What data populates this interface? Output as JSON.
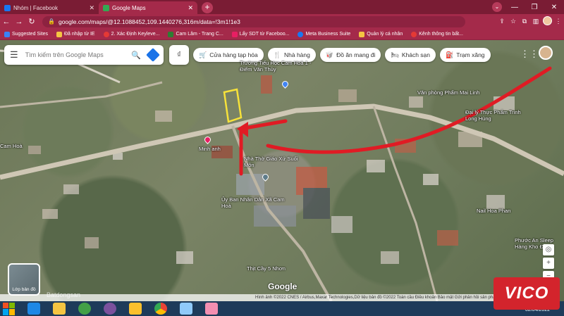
{
  "browser": {
    "tabs": [
      {
        "title": "Nhóm | Facebook",
        "active": false
      },
      {
        "title": "Google Maps",
        "active": true
      }
    ],
    "new_tab": "+",
    "url": "google.com/maps/@12.1088452,109.1440276,316m/data=!3m1!1e3",
    "bookmarks": [
      {
        "label": "Suggested Sites",
        "color": "#3b82f6"
      },
      {
        "label": "Đã nhập từ IE",
        "color": "#f5c542"
      },
      {
        "label": "2. Xác Định Keyleve...",
        "color": "#e53935"
      },
      {
        "label": "Cam Lâm - Trang C...",
        "color": "#2e7d32"
      },
      {
        "label": "Lấy SDT từ Faceboo...",
        "color": "#e91e63"
      },
      {
        "label": "Meta Business Suite",
        "color": "#1877f2"
      },
      {
        "label": "Quản lý cá nhân",
        "color": "#f5c542"
      },
      {
        "label": "Kênh thông tin bất...",
        "color": "#e53935"
      }
    ]
  },
  "maps": {
    "search_placeholder": "Tìm kiếm trên Google Maps",
    "chips": [
      {
        "icon": "cart-icon",
        "glyph": "🛒",
        "label": "Cửa hàng tạp hóa"
      },
      {
        "icon": "restaurant-icon",
        "glyph": "🍴",
        "label": "Nhà hàng"
      },
      {
        "icon": "takeout-icon",
        "glyph": "🥡",
        "label": "Đồ ăn mang đi"
      },
      {
        "icon": "hotel-icon",
        "glyph": "🛏",
        "label": "Khách sạn"
      },
      {
        "icon": "gas-station-icon",
        "glyph": "⛽",
        "label": "Trạm xăng"
      }
    ],
    "labels": {
      "school": "Trường Tiểu Học Cam Hoà 1 - Điểm Văn Thủy",
      "office": "Văn phòng Phẩm Mai Linh",
      "agent": "Đại lý Thực Phẩm Trinh Long Hùng",
      "minh_anh": "Minh anh",
      "uy_ban": "Ủy Ban Nhân Dân Xã Cam Hoà",
      "church": "Nhà Thờ Giáo Xứ Suối Môn",
      "cay5": "Thịt Cầy 5 Nhơn",
      "nail": "Nail Hoa Phan",
      "hoa": "Cam Hoà",
      "lam": "Phước An Sleep Hàng Kho Đ"
    },
    "layers_label": "Lớp bản đồ",
    "brand": "Google",
    "credit": "Hình ảnh ©2022 CNES / Airbus,Maxar Technologies,Dữ liệu bản đồ ©2022    Toàn cầu    Điều khoản    Bảo mật    Gửi phản hồi sản phẩm    10 m",
    "watermark": "Batdongsan",
    "zoom_in": "+",
    "zoom_out": "−"
  },
  "taskbar": {
    "date": "02/04/2022"
  },
  "overlay": {
    "logo": "VICO"
  },
  "colors": {
    "tab_bg": "#7a1c34",
    "toolbar": "#a42a4a",
    "arrow_red": "#e01b24",
    "lot_yellow": "#f7e23a"
  }
}
